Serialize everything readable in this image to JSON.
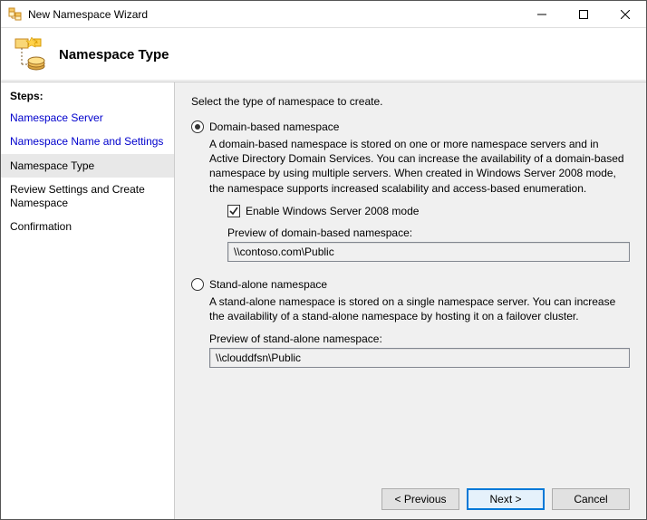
{
  "window": {
    "title": "New Namespace Wizard"
  },
  "header": {
    "title": "Namespace Type"
  },
  "sidebar": {
    "heading": "Steps:",
    "items": [
      {
        "label": "Namespace Server",
        "kind": "link"
      },
      {
        "label": "Namespace Name and Settings",
        "kind": "link"
      },
      {
        "label": "Namespace Type",
        "kind": "current"
      },
      {
        "label": "Review Settings and Create Namespace",
        "kind": "future"
      },
      {
        "label": "Confirmation",
        "kind": "future"
      }
    ]
  },
  "content": {
    "instruction": "Select the type of namespace to create.",
    "option1": {
      "label": "Domain-based namespace",
      "selected": true,
      "description": "A domain-based namespace is stored on one or more namespace servers and in Active Directory Domain Services. You can increase the availability of a domain-based namespace by using multiple servers. When created in Windows Server 2008 mode, the namespace supports increased scalability and access-based enumeration.",
      "checkbox_label": "Enable Windows Server 2008 mode",
      "checkbox_checked": true,
      "preview_label": "Preview of domain-based namespace:",
      "preview_value": "\\\\contoso.com\\Public"
    },
    "option2": {
      "label": "Stand-alone namespace",
      "selected": false,
      "description": "A stand-alone namespace is stored on a single namespace server. You can increase the availability of a stand-alone namespace by hosting it on a failover cluster.",
      "preview_label": "Preview of stand-alone namespace:",
      "preview_value": "\\\\clouddfsn\\Public"
    }
  },
  "buttons": {
    "previous": "< Previous",
    "next": "Next >",
    "cancel": "Cancel"
  }
}
